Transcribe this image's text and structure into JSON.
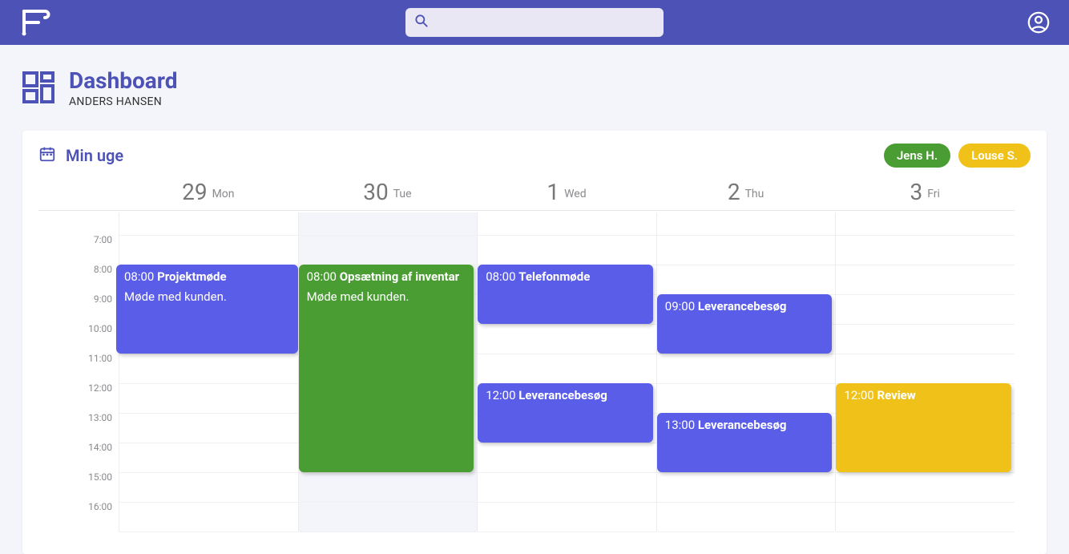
{
  "colors": {
    "brand": "#4d53b6",
    "purple": "#5a5de8",
    "green": "#4a9d33",
    "yellow": "#f0c219"
  },
  "search": {
    "placeholder": ""
  },
  "dashboard": {
    "title": "Dashboard",
    "user": "ANDERS HANSEN"
  },
  "calendar": {
    "title": "Min uge",
    "chips": [
      {
        "label": "Jens H.",
        "color": "green"
      },
      {
        "label": "Louse S.",
        "color": "yellow"
      }
    ],
    "hourStart": 7,
    "hourEnd": 16,
    "timeLabels": [
      "7:00",
      "8:00",
      "9:00",
      "10:00",
      "11:00",
      "12:00",
      "13:00",
      "14:00",
      "15:00",
      "16:00"
    ],
    "days": [
      {
        "num": "29",
        "dow": "Mon",
        "today": false
      },
      {
        "num": "30",
        "dow": "Tue",
        "today": true
      },
      {
        "num": "1",
        "dow": "Wed",
        "today": false
      },
      {
        "num": "2",
        "dow": "Thu",
        "today": false
      },
      {
        "num": "3",
        "dow": "Fri",
        "today": false
      }
    ],
    "events": [
      {
        "day": 0,
        "start": 8,
        "end": 11,
        "color": "purple",
        "time": "08:00",
        "title": "Projektmøde",
        "desc": "Møde med kunden."
      },
      {
        "day": 1,
        "start": 8,
        "end": 15,
        "color": "green",
        "time": "08:00",
        "title": "Opsætning af inventar",
        "desc": "Møde med kunden."
      },
      {
        "day": 2,
        "start": 8,
        "end": 10,
        "color": "purple",
        "time": "08:00",
        "title": "Telefonmøde",
        "desc": ""
      },
      {
        "day": 2,
        "start": 12,
        "end": 14,
        "color": "purple",
        "time": "12:00",
        "title": "Leverancebesøg",
        "desc": ""
      },
      {
        "day": 3,
        "start": 9,
        "end": 11,
        "color": "purple",
        "time": "09:00",
        "title": "Leverancebesøg",
        "desc": ""
      },
      {
        "day": 3,
        "start": 13,
        "end": 15,
        "color": "purple",
        "time": "13:00",
        "title": "Leverancebesøg",
        "desc": ""
      },
      {
        "day": 4,
        "start": 12,
        "end": 15,
        "color": "yellow",
        "time": "12:00",
        "title": "Review",
        "desc": ""
      }
    ]
  }
}
